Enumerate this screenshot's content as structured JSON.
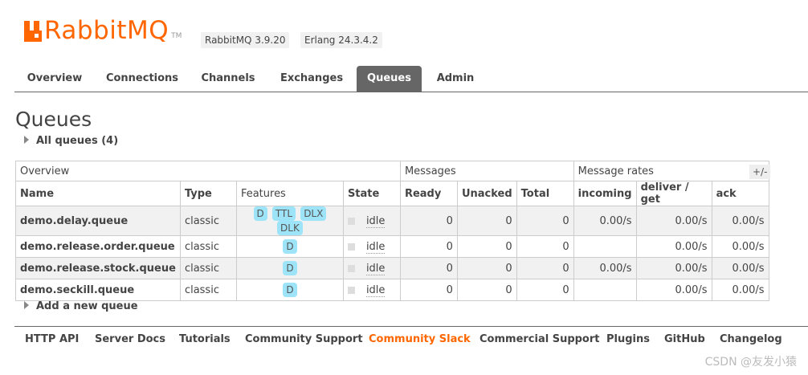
{
  "header": {
    "logo_text": "RabbitMQ",
    "logo_tm": "TM",
    "version": "RabbitMQ 3.9.20",
    "erlang": "Erlang 24.3.4.2",
    "brand_color": "#ff6600"
  },
  "tabs": [
    {
      "label": "Overview",
      "active": false
    },
    {
      "label": "Connections",
      "active": false
    },
    {
      "label": "Channels",
      "active": false
    },
    {
      "label": "Exchanges",
      "active": false
    },
    {
      "label": "Queues",
      "active": true
    },
    {
      "label": "Admin",
      "active": false
    }
  ],
  "page_title": "Queues",
  "all_queues_label": "All queues (4)",
  "table": {
    "groups": [
      "Overview",
      "Messages",
      "Message rates"
    ],
    "columns": [
      "Name",
      "Type",
      "Features",
      "State",
      "Ready",
      "Unacked",
      "Total",
      "incoming",
      "deliver / get",
      "ack"
    ],
    "toggle_label": "+/-",
    "rows": [
      {
        "name": "demo.delay.queue",
        "type": "classic",
        "features": [
          "D",
          "TTL",
          "DLX",
          "DLK"
        ],
        "state": "idle",
        "ready": "0",
        "unacked": "0",
        "total": "0",
        "incoming": "0.00/s",
        "deliver": "0.00/s",
        "ack": "0.00/s"
      },
      {
        "name": "demo.release.order.queue",
        "type": "classic",
        "features": [
          "D"
        ],
        "state": "idle",
        "ready": "0",
        "unacked": "0",
        "total": "0",
        "incoming": "",
        "deliver": "0.00/s",
        "ack": "0.00/s"
      },
      {
        "name": "demo.release.stock.queue",
        "type": "classic",
        "features": [
          "D"
        ],
        "state": "idle",
        "ready": "0",
        "unacked": "0",
        "total": "0",
        "incoming": "0.00/s",
        "deliver": "0.00/s",
        "ack": "0.00/s"
      },
      {
        "name": "demo.seckill.queue",
        "type": "classic",
        "features": [
          "D"
        ],
        "state": "idle",
        "ready": "0",
        "unacked": "0",
        "total": "0",
        "incoming": "",
        "deliver": "0.00/s",
        "ack": "0.00/s"
      }
    ]
  },
  "add_queue_label": "Add a new queue",
  "footer": [
    {
      "label": "HTTP API",
      "highlight": false
    },
    {
      "label": "Server Docs",
      "highlight": false
    },
    {
      "label": "Tutorials",
      "highlight": false
    },
    {
      "label": "Community Support",
      "highlight": false
    },
    {
      "label": "Community Slack",
      "highlight": true
    },
    {
      "label": "Commercial Support",
      "highlight": false
    },
    {
      "label": "Plugins",
      "highlight": false
    },
    {
      "label": "GitHub",
      "highlight": false
    },
    {
      "label": "Changelog",
      "highlight": false
    }
  ],
  "watermark": "CSDN @友发小猿"
}
